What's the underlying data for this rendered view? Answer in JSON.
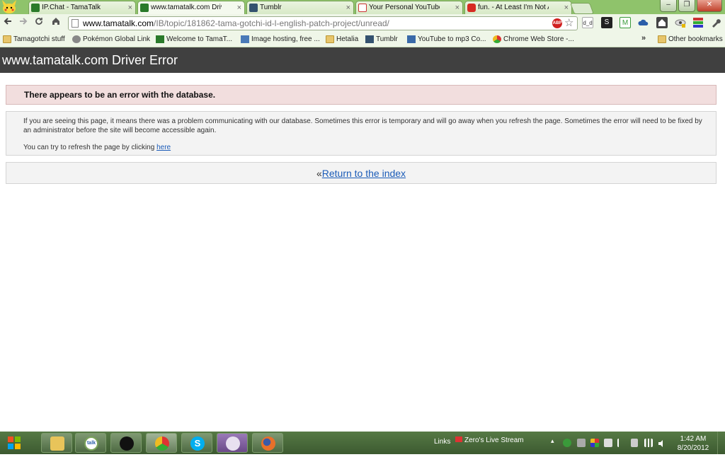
{
  "browser": {
    "tabs": [
      {
        "title": "IP.Chat - TamaTalk",
        "active": false
      },
      {
        "title": "www.tamatalk.com Driver",
        "active": true
      },
      {
        "title": "Tumblr",
        "active": false
      },
      {
        "title": "Your Personal YouTube Di",
        "active": false
      },
      {
        "title": "fun. - At Least I'm Not As S",
        "active": false
      }
    ],
    "tab_close_glyph": "×",
    "window_buttons": {
      "minimize": "–",
      "maximize": "❐",
      "close": "✕"
    },
    "address": {
      "host": "www.tamatalk.com",
      "path": "/IB/topic/181862-tama-gotchi-id-l-english-patch-project/unread/"
    },
    "adblock_label": "ABP",
    "bookmarks": [
      {
        "label": "Tamagotchi stuff",
        "icon": "folder-icon"
      },
      {
        "label": "Pokémon Global Link",
        "icon": "pokeball-icon"
      },
      {
        "label": "Welcome to TamaT...",
        "icon": "tamatalk-icon"
      },
      {
        "label": "Image hosting, free ...",
        "icon": "photobucket-icon"
      },
      {
        "label": "Hetalia",
        "icon": "folder-icon"
      },
      {
        "label": "Tumblr",
        "icon": "tumblr-icon"
      },
      {
        "label": "YouTube to mp3 Co...",
        "icon": "yt-mp3-icon"
      },
      {
        "label": "Chrome Web Store -...",
        "icon": "chrome-store-icon"
      }
    ],
    "bookmarks_more": "»",
    "other_bookmarks": "Other bookmarks"
  },
  "page": {
    "title": "www.tamatalk.com Driver Error",
    "error_heading": "There appears to be an error with the database.",
    "message": "If you are seeing this page, it means there was a problem communicating with our database. Sometimes this error is temporary and will go away when you refresh the page. Sometimes the error will need to be fixed by an administrator before the site will become accessible again.",
    "refresh_text": "You can try to refresh the page by clicking ",
    "refresh_link": "here",
    "return_prefix": "«",
    "return_link": "Return to the index"
  },
  "taskbar": {
    "pinned": [
      "explorer-icon",
      "gtalk-icon",
      "pidgin-icon",
      "chrome-icon",
      "skype-icon",
      "app-icon",
      "firefox-icon"
    ],
    "gtalk_label": "talk",
    "skype_label": "S",
    "links_label": "Links",
    "stream_label": "Zero's Live Stream",
    "tray_expand": "▴",
    "time": "1:42 AM",
    "date": "8/20/2012"
  },
  "colors": {
    "chrome_theme": "#8fc36b",
    "page_header": "#404040",
    "error_bg": "#f2dede",
    "link": "#1a5bb8",
    "taskbar": "#4a6b3b"
  }
}
